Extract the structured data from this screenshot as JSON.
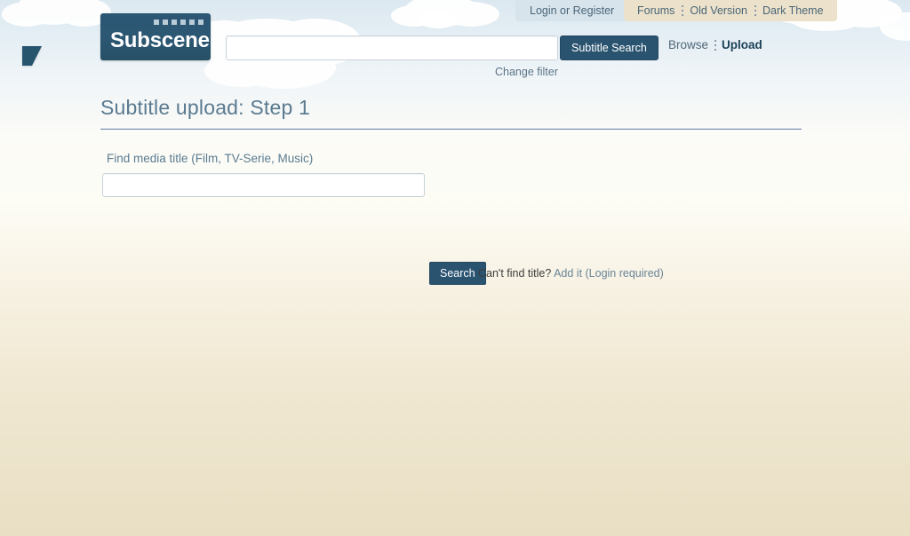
{
  "topbar": {
    "login_label": "Login or Register",
    "links": [
      {
        "label": "Forums"
      },
      {
        "label": "Old Version"
      },
      {
        "label": "Dark Theme"
      }
    ]
  },
  "header": {
    "logo_text": "Subscene",
    "search_value": "",
    "search_placeholder": "",
    "subtitle_search_label": "Subtitle Search",
    "change_filter_label": "Change filter",
    "nav": [
      {
        "label": "Browse",
        "active": false
      },
      {
        "label": "Upload",
        "active": true
      }
    ]
  },
  "content": {
    "page_title": "Subtitle upload: Step 1",
    "field_label": "Find media title (Film, TV-Serie, Music)",
    "media_input_value": "",
    "media_input_placeholder": "",
    "search_button_label": "Search",
    "cantfind_text": "Can't find title? ",
    "cantfind_link": "Add it (Login required)"
  },
  "colors": {
    "brand_dark_blue": "#2a5370",
    "logo_blue": "#2d5874",
    "title_blue": "#5a7a90",
    "rule_blue": "#5e7ba3",
    "topbar_left_bg": "#d7e4ec",
    "topbar_right_bg": "#ece2cb",
    "sky": "#dce8f0",
    "page_cream": "#e9dfc4",
    "link_blue": "#5b7385"
  }
}
